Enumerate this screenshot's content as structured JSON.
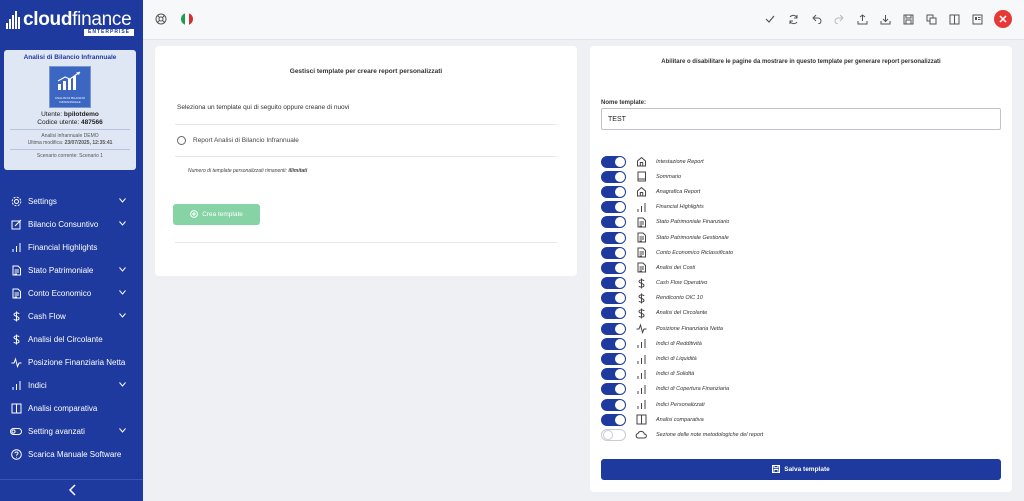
{
  "logo": {
    "word_a": "cloud",
    "word_b": "finance",
    "sub": "ENTERPRISE"
  },
  "card": {
    "title": "Analisi di Bilancio Infrannuale",
    "image_caption": "ANALISI DI BILANCIO INFRANNUALE",
    "user_label": "Utente:",
    "user_value": "bpilotdemo",
    "code_label": "Codice utente:",
    "code_value": "487566",
    "analysis": "Analisi infrannuale DEMO",
    "modified_label": "Ultima modifica:",
    "modified_value": "23/07/2025, 12:35:41",
    "scenario": "Scenario corrente: Scenario 1"
  },
  "menu": [
    {
      "label": "Settings",
      "icon": "gear-icon",
      "chevron": true
    },
    {
      "label": "Bilancio Consuntivo",
      "icon": "edit-icon",
      "chevron": true
    },
    {
      "label": "Financial Highlights",
      "icon": "bar-chart-icon",
      "chevron": false
    },
    {
      "label": "Stato Patrimoniale",
      "icon": "document-icon",
      "chevron": true
    },
    {
      "label": "Conto Economico",
      "icon": "document-icon",
      "chevron": true
    },
    {
      "label": "Cash Flow",
      "icon": "dollar-icon",
      "chevron": true
    },
    {
      "label": "Analisi del Circolante",
      "icon": "dollar-icon",
      "chevron": false
    },
    {
      "label": "Posizione Finanziaria Netta",
      "icon": "pulse-icon",
      "chevron": false
    },
    {
      "label": "Indici",
      "icon": "bar-chart-icon",
      "chevron": true
    },
    {
      "label": "Analisi comparativa",
      "icon": "columns-icon",
      "chevron": false
    },
    {
      "label": "Setting avanzati",
      "icon": "toggle-icon",
      "chevron": true
    },
    {
      "label": "Scarica Manuale Software",
      "icon": "help-icon",
      "chevron": false
    }
  ],
  "collapse_icon": "chevron-left-icon",
  "topbar": {
    "left_icons": [
      "support-icon",
      "italy-flag-icon"
    ],
    "right_icons": [
      "check-icon",
      "refresh-icon",
      "undo-icon",
      "redo-icon",
      "upload-icon",
      "download-icon",
      "save-icon",
      "copy-icon",
      "columns-icon",
      "layout-icon"
    ],
    "close_icon": "close-icon"
  },
  "left_panel": {
    "title": "Gestisci template per creare report personalizzati",
    "instruction": "Seleziona un template qui di seguito oppure creane di nuovi",
    "template_option": "Report Analisi di Bilancio Infrannuale",
    "remaining_label": "Numero di template personalizzati rimanenti:",
    "remaining_value": "illimitati",
    "create_button": "Crea template"
  },
  "right_panel": {
    "title": "Abilitare o disabilitare le pagine da mostrare in questo template per generare report personalizzati",
    "name_label": "Nome template:",
    "name_value": "TEST",
    "pages": [
      {
        "label": "Intestazione Report",
        "icon": "home-icon",
        "enabled": true
      },
      {
        "label": "Sommario",
        "icon": "book-icon",
        "enabled": true
      },
      {
        "label": "Anagrafica Report",
        "icon": "home-icon",
        "enabled": true
      },
      {
        "label": "Financial Highlights",
        "icon": "bar-chart-icon",
        "enabled": true
      },
      {
        "label": "Stato Patrimoniale Finanziario",
        "icon": "document-icon",
        "enabled": true
      },
      {
        "label": "Stato Patrimoniale Gestionale",
        "icon": "document-icon",
        "enabled": true
      },
      {
        "label": "Conto Economico Riclassificato",
        "icon": "document-icon",
        "enabled": true
      },
      {
        "label": "Analisi dei Costi",
        "icon": "document-icon",
        "enabled": true
      },
      {
        "label": "Cash Flow Operativo",
        "icon": "dollar-icon",
        "enabled": true
      },
      {
        "label": "Rendiconto OIC 10",
        "icon": "dollar-icon",
        "enabled": true
      },
      {
        "label": "Analisi del Circolante",
        "icon": "dollar-icon",
        "enabled": true
      },
      {
        "label": "Posizione Finanziaria Netta",
        "icon": "pulse-icon",
        "enabled": true
      },
      {
        "label": "Indici di Redditività",
        "icon": "bar-chart-icon",
        "enabled": true
      },
      {
        "label": "Indici di Liquidità",
        "icon": "bar-chart-icon",
        "enabled": true
      },
      {
        "label": "Indici di Solidità",
        "icon": "bar-chart-icon",
        "enabled": true
      },
      {
        "label": "Indici di Copertura Finanziaria",
        "icon": "bar-chart-icon",
        "enabled": true
      },
      {
        "label": "Indici Personalizzati",
        "icon": "bar-chart-icon",
        "enabled": true
      },
      {
        "label": "Analisi comparativa",
        "icon": "columns-icon",
        "enabled": true
      },
      {
        "label": "Sezione delle note metodologiche del report",
        "icon": "cloud-icon",
        "enabled": false
      }
    ],
    "save_button": "Salva template"
  },
  "colors": {
    "primary": "#1e3a9e",
    "create_button": "#86d3a6",
    "close": "#e53935"
  }
}
